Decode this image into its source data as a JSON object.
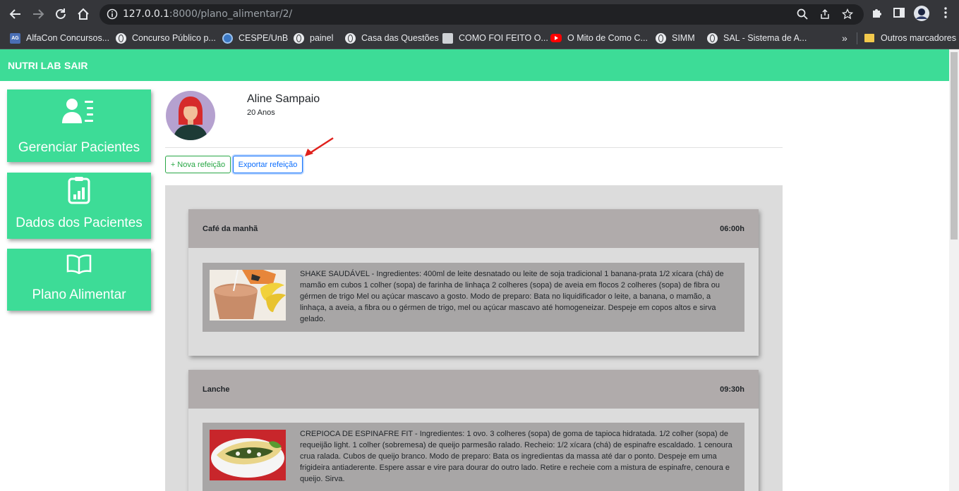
{
  "browser": {
    "url_host": "127.0.0.1",
    "url_rest": ":8000/plano_alimentar/2/",
    "bookmarks": [
      {
        "label": "AlfaCon Concursos...",
        "icon": "alfacon-icon"
      },
      {
        "label": "Concurso Público p...",
        "icon": "globe-icon"
      },
      {
        "label": "CESPE/UnB",
        "icon": "cespe-icon"
      },
      {
        "label": "painel",
        "icon": "globe-icon"
      },
      {
        "label": "Casa das Questões",
        "icon": "globe-icon"
      },
      {
        "label": "COMO FOI FEITO O...",
        "icon": "video-icon"
      },
      {
        "label": "O Mito de Como C...",
        "icon": "youtube-icon"
      },
      {
        "label": "SIMM",
        "icon": "globe-icon"
      },
      {
        "label": "SAL - Sistema de A...",
        "icon": "globe-icon"
      }
    ],
    "overflow": "»",
    "other_bookmarks": "Outros marcadores"
  },
  "navbar": {
    "brand": "NUTRI LAB",
    "logout": "SAIR",
    "color": "#3ddc97"
  },
  "sidebar": {
    "items": [
      {
        "label": "Gerenciar Pacientes",
        "icon": "patients-list-icon"
      },
      {
        "label": "Dados dos Pacientes",
        "icon": "clipboard-chart-icon"
      },
      {
        "label": "Plano Alimentar",
        "icon": "open-book-icon"
      }
    ]
  },
  "patient": {
    "name": "Aline Sampaio",
    "age": "20 Anos"
  },
  "actions": {
    "new_meal": "+ Nova refeição",
    "export_meal": "Exportar refeição"
  },
  "meals": [
    {
      "title": "Café da manhã",
      "time": "06:00h",
      "food": {
        "image": "smoothie-photo",
        "description": "SHAKE SAUDÁVEL - Ingredientes: 400ml de leite desnatado ou leite de soja tradicional 1 banana-prata 1/2 xícara (chá) de mamão em cubos 1 colher (sopa) de farinha de linhaça 2 colheres (sopa) de aveia em flocos 2 colheres (sopa) de fibra ou gérmen de trigo Mel ou açúcar mascavo a gosto. Modo de preparo: Bata no liquidificador o leite, a banana, o mamão, a linhaça, a aveia, a fibra ou o gérmen de trigo, mel ou açúcar mascavo até homogeneizar. Despeje em copos altos e sirva gelado."
      }
    },
    {
      "title": "Lanche",
      "time": "09:30h",
      "food": {
        "image": "crepe-photo",
        "description": "CREPIOCA DE ESPINAFRE FIT - Ingredientes: 1 ovo. 3 colheres (sopa) de goma de tapioca hidratada. 1/2 colher (sopa) de requeijão light. 1 colher (sobremesa) de queijo parmesão ralado. Recheio: 1/2 xícara (chá) de espinafre escaldado. 1 cenoura crua ralada. Cubos de queijo branco. Modo de preparo: Bata os ingredientas da massa até dar o ponto. Despeje em uma frigideira antiaderente. Espere assar e vire para dourar do outro lado. Retire e recheie com a mistura de espinafre, cenoura e queijo. Sirva."
      }
    }
  ]
}
